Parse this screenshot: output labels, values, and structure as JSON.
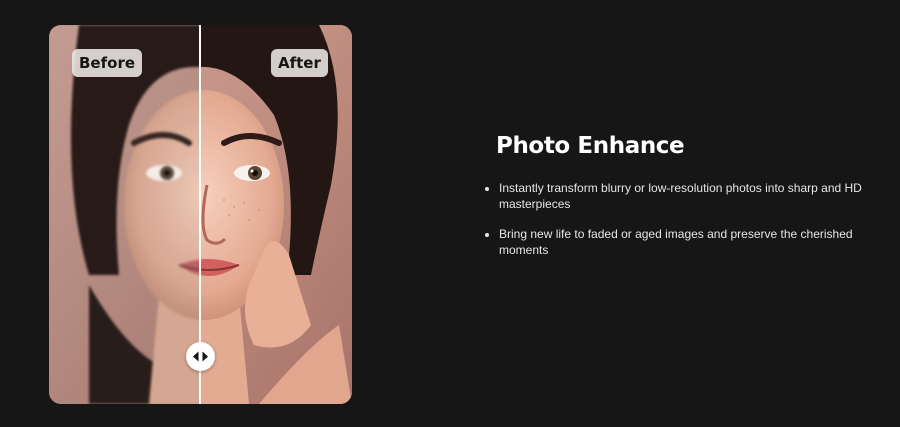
{
  "comparison": {
    "before_label": "Before",
    "after_label": "After",
    "slider_position": 0.5,
    "handle_icon": "left-right-arrows-icon",
    "image_subject": "portrait"
  },
  "feature": {
    "title": "Photo Enhance",
    "bullets": [
      "Instantly transform blurry or low-resolution photos into sharp and HD masterpieces",
      "Bring new life to faded or aged images and preserve the cherished moments"
    ]
  },
  "colors": {
    "background": "#161616",
    "text_primary": "#ffffff",
    "text_secondary": "#e6e6e6",
    "tag_background": "#ece8e6"
  }
}
